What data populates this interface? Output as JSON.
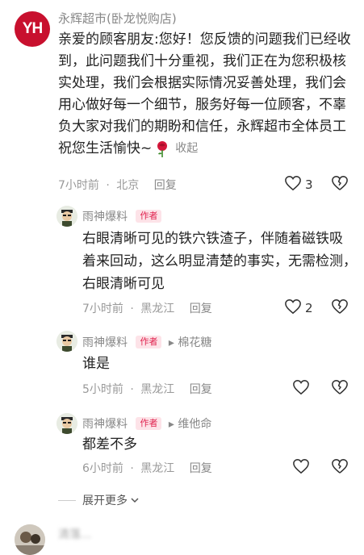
{
  "main_comment": {
    "avatar_text": "YH",
    "username": "永辉超市(卧龙悦购店)",
    "lines": [
      "亲爱的顾客朋友:您好！您反馈的问题我们已经收",
      "到，此问题我们十分重视，我们正在为您积极核",
      "实处理，我们会根据实际情况妥善处理，我们会",
      "用心做好每一个细节，服务好每一位顾客，不辜",
      "负大家对我们的期盼和信任，永辉超市全体员工",
      "祝您生活愉快~"
    ],
    "collapse_label": "收起",
    "time": "7小时前",
    "location": "北京",
    "reply_label": "回复",
    "like_count": "3",
    "emoji_icon": "rose-emoji"
  },
  "replies": [
    {
      "username": "雨神爆料",
      "badge": "作者",
      "reply_to": "",
      "lines": [
        "右眼清晰可见的铁穴铁渣子，伴随着磁铁吸",
        "着来回动，这么明显清楚的事实，无需检测，",
        "右眼清晰可见"
      ],
      "time": "7小时前",
      "location": "黑龙江",
      "reply_label": "回复",
      "like_count": "2"
    },
    {
      "username": "雨神爆料",
      "badge": "作者",
      "reply_to": "棉花糖",
      "lines": [
        "谁是"
      ],
      "time": "5小时前",
      "location": "黑龙江",
      "reply_label": "回复",
      "like_count": ""
    },
    {
      "username": "雨神爆料",
      "badge": "作者",
      "reply_to": "维他命",
      "lines": [
        "都差不多"
      ],
      "time": "6小时前",
      "location": "黑龙江",
      "reply_label": "回复",
      "like_count": ""
    }
  ],
  "expand_more": "展开更多",
  "next_comment": {
    "username": "清落..."
  },
  "colors": {
    "brand_red": "#c8102e",
    "badge_text": "#e0224e",
    "badge_bg": "#fde3e8",
    "muted": "#999999"
  }
}
